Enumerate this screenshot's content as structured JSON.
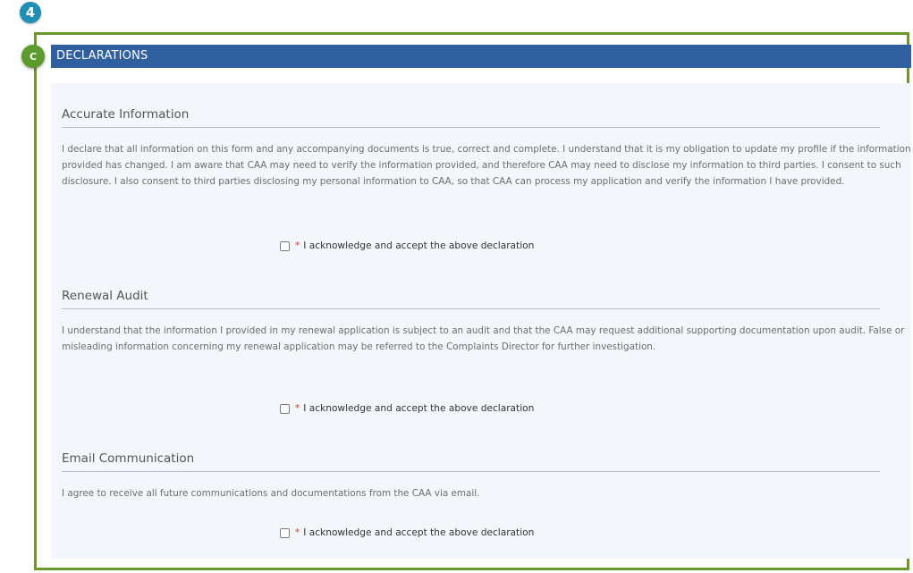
{
  "step_badge": "4",
  "section": {
    "badge": "C",
    "title": "DECLARATIONS"
  },
  "blocks": [
    {
      "title": "Accurate Information",
      "text": "I declare that all information on this form and any accompanying documents is true, correct and complete. I understand that it is my obligation to update my profile if the information provided has changed. I am aware that CAA may need to verify the information provided, and therefore CAA may need to disclose my information to third parties. I consent to such disclosure. I also consent to third parties disclosing my personal information to CAA, so that CAA can process my application and verify the information I have provided.",
      "required_mark": "*",
      "ack_label": "I acknowledge and accept the above declaration"
    },
    {
      "title": "Renewal Audit",
      "text": "I understand that the information I provided in my renewal application is subject to an audit and that the CAA may request additional supporting documentation upon audit. False or misleading information concerning my renewal application may be referred to the Complaints Director for further investigation.",
      "required_mark": "*",
      "ack_label": "I acknowledge and accept the above declaration"
    },
    {
      "title": "Email Communication",
      "text": "I agree to receive all future communications and documentations from the CAA via email.",
      "required_mark": "*",
      "ack_label": "I acknowledge and accept the above declaration"
    }
  ],
  "colors": {
    "header_bg": "#2f5f9e",
    "frame_border": "#6a9a2c",
    "step_badge": "#1f8fb5",
    "section_badge": "#5e9b2e",
    "required": "#dd3333"
  }
}
